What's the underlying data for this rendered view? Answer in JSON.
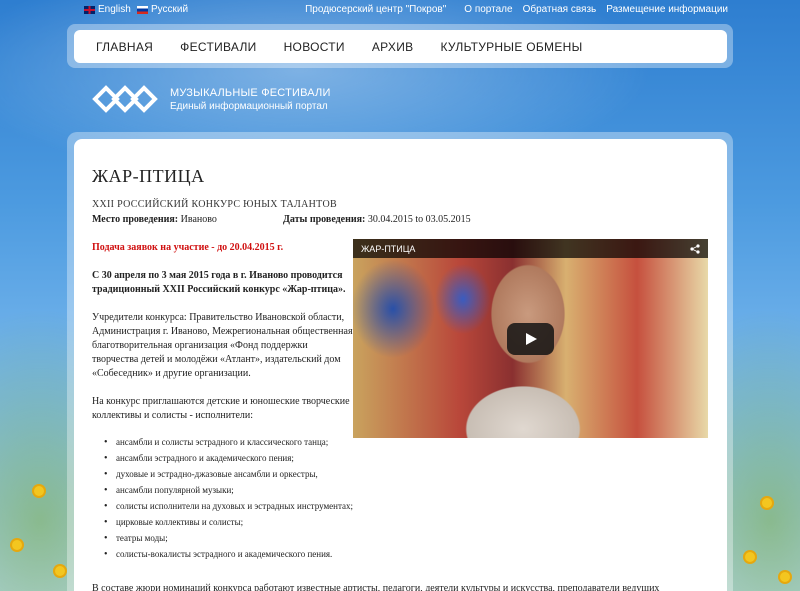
{
  "topbar": {
    "lang_en": "English",
    "lang_ru": "Русский",
    "links": [
      "Продюсерский центр \"Покров\"",
      "О портале",
      "Обратная связь",
      "Размещение информации"
    ]
  },
  "nav": [
    "ГЛАВНАЯ",
    "ФЕСТИВАЛИ",
    "НОВОСТИ",
    "АРХИВ",
    "КУЛЬТУРНЫЕ ОБМЕНЫ"
  ],
  "logo": {
    "title": "МУЗЫКАЛЬНЫЕ ФЕСТИВАЛИ",
    "subtitle": "Единый информационный портал"
  },
  "event": {
    "title": "ЖАР-ПТИЦА",
    "subtitle": "XXII РОССИЙСКИЙ КОНКУРС ЮНЫХ ТАЛАНТОВ",
    "place_label": "Место проведения:",
    "place_value": "Иваново",
    "dates_label": "Даты проведения:",
    "dates_value": "30.04.2015 to 03.05.2015",
    "deadline": "Подача заявок на участие - до 20.04.2015 г.",
    "intro": "С 30 апреля по 3 мая 2015 года в г. Иваново проводится традиционный XXII Российский конкурс «Жар-птица».",
    "founders": "Учредители конкурса: Правительство Ивановской области, Администрация г. Иваново, Межрегиональная общественная благотворительная организация «Фонд поддержки творчества детей и молодёжи «Атлант», издательский дом «Собеседник» и другие организации.",
    "invite": "На конкурс приглашаются детские и юношеские творческие коллективы и солисты - исполнители:",
    "categories": [
      "ансамбли и солисты эстрадного и классического танца;",
      "ансамбли эстрадного и академического пения;",
      "духовые и эстрадно-джазовые ансамбли и оркестры,",
      "ансамбли популярной музыки;",
      "солисты исполнители на духовых и эстрадных инструментах;",
      "цирковые коллективы и солисты;",
      "театры моды;",
      "солисты-вокалисты эстрадного и академического пения."
    ],
    "jury": "В составе жюри номинаций конкурса работают известные артисты, педагоги, деятели культуры и искусства, преподаватели ведущих"
  },
  "video": {
    "title": "ЖАР-ПТИЦА"
  }
}
